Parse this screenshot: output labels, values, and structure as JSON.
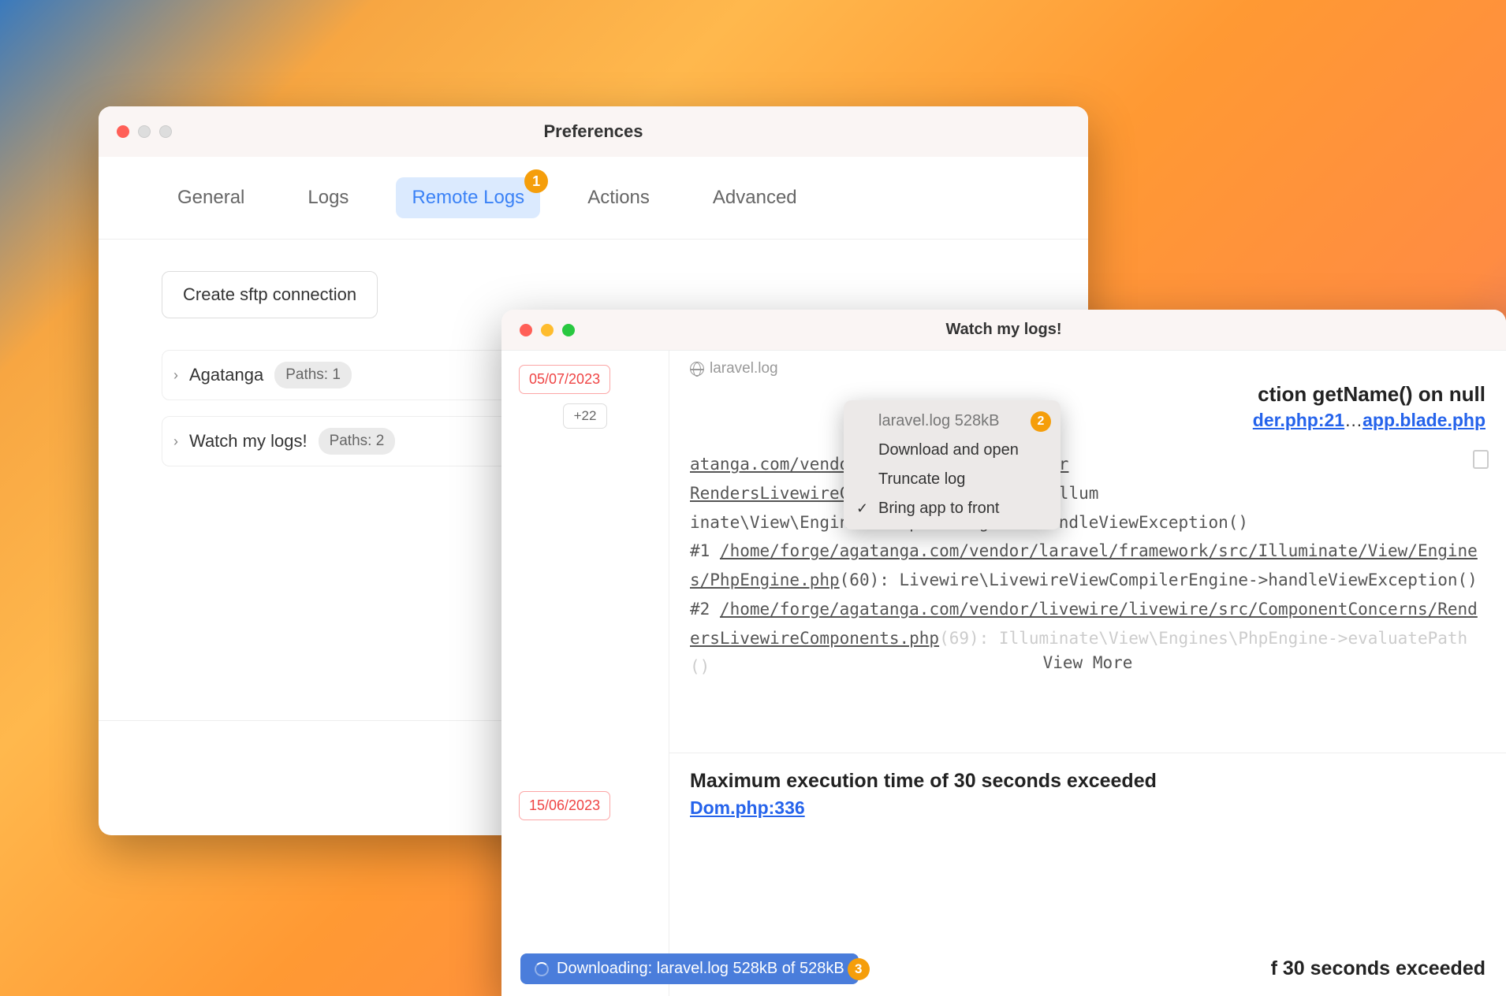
{
  "prefs": {
    "title": "Preferences",
    "tabs": {
      "general": "General",
      "logs": "Logs",
      "remote_logs": "Remote Logs",
      "actions": "Actions",
      "advanced": "Advanced"
    },
    "badge_1": "1",
    "create_btn": "Create sftp connection",
    "connections": [
      {
        "name": "Agatanga",
        "paths": "Paths: 1"
      },
      {
        "name": "Watch my logs!",
        "paths": "Paths: 2"
      }
    ]
  },
  "logs": {
    "title": "Watch my logs!",
    "file_name": "laravel.log",
    "dates": {
      "d1": "05/07/2023",
      "d1_extra": "+22",
      "d2": "15/06/2023"
    },
    "menu": {
      "item1": "laravel.log 528kB",
      "item2": "Download and open",
      "item3": "Truncate log",
      "item4": "Bring app to front",
      "badge_2": "2"
    },
    "err1": {
      "title_tail": "ction getName() on null",
      "link1": "der.php:21",
      "ellipsis": "…",
      "link2": "app.blade.php",
      "trace_l1a": "atanga.com/vendor/livewire/livewire/sr",
      "trace_l2a": "RendersLivewireComponents.php",
      "trace_l2b": "(106): Illum",
      "trace_l3": "inate\\View\\Engines\\CompilerEngine->handleViewException()",
      "trace_l4a": "#1 ",
      "trace_l4b": "/home/forge/agatanga.com/vendor/laravel/framework/src/Illuminate/View/Engines/PhpEngine.php",
      "trace_l4c": "(60): Livewire\\LivewireViewCompilerEngine->handleViewException()",
      "trace_l5a": "#2 ",
      "trace_l5b": "/home/forge/agatanga.com/vendor/livewire/livewire/src/ComponentConcerns/RendersLivewireComponents.php",
      "trace_l5c": "(69): Illuminate\\View\\Engines\\PhpEngine->evaluatePath()",
      "view_more": "View More"
    },
    "err2": {
      "title": "Maximum execution time of 30 seconds exceeded",
      "link": "Dom.php:336"
    },
    "err3_tail": "f 30 seconds exceeded",
    "download": {
      "text": "Downloading: laravel.log 528kB of 528kB",
      "badge_3": "3"
    }
  }
}
